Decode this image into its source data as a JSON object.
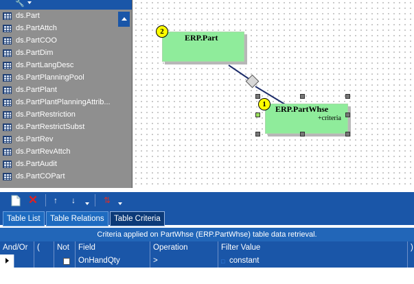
{
  "table_list": {
    "items": [
      "ds.Part",
      "ds.PartAttch",
      "ds.PartCOO",
      "ds.PartDim",
      "ds.PartLangDesc",
      "ds.PartPlanningPool",
      "ds.PartPlant",
      "ds.PartPlantPlanningAttrib...",
      "ds.PartRestriction",
      "ds.PartRestrictSubst",
      "ds.PartRev",
      "ds.PartRevAttch",
      "ds.PartAudit",
      "ds.PartCOPart"
    ]
  },
  "diagram": {
    "nodes": [
      {
        "badge": "2",
        "title": "ERP.Part",
        "subtitle": ""
      },
      {
        "badge": "1",
        "title": "ERP.PartWhse",
        "subtitle": "+criteria"
      }
    ]
  },
  "toolbar": {
    "icons": [
      "new-document-icon",
      "delete-icon",
      "move-up-icon",
      "move-down-icon",
      "sort-icon"
    ]
  },
  "tabs": [
    {
      "label": "Table List",
      "active": false
    },
    {
      "label": "Table Relations",
      "active": false
    },
    {
      "label": "Table Criteria",
      "active": true
    }
  ],
  "criteria": {
    "caption": "Criteria applied on PartWhse (ERP.PartWhse)  table data retrieval.",
    "columns": [
      "And/Or",
      "(",
      "Not",
      "Field",
      "Operation",
      "Filter Value",
      ")"
    ],
    "rows": [
      {
        "and_or": "",
        "paren_open": "",
        "not": false,
        "field": "OnHandQty",
        "operation": ">",
        "filter_value": "constant",
        "paren_close": ""
      }
    ]
  },
  "colors": {
    "panel_blue": "#1a56a8",
    "node_green": "#8fec9b",
    "badge_yellow": "#ffff00"
  }
}
